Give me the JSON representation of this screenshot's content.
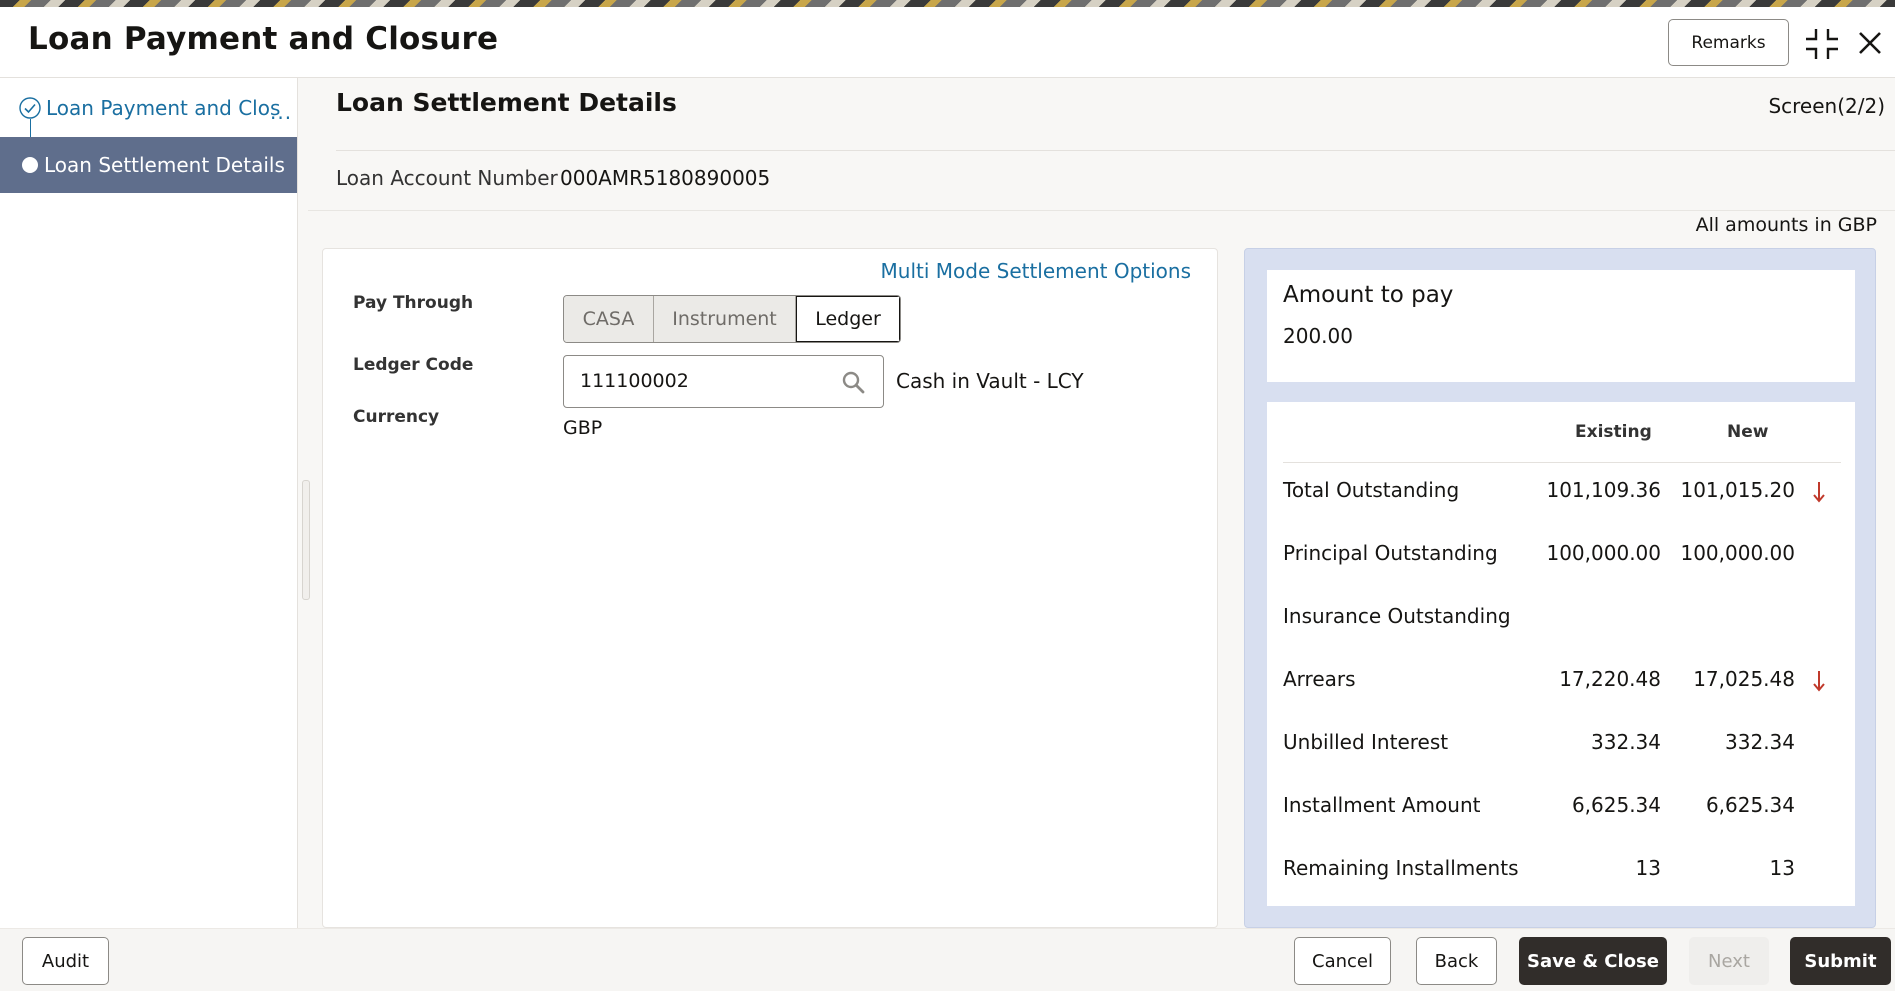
{
  "window": {
    "title": "Loan Payment and Closure",
    "remarks_label": "Remarks",
    "minimize_icon": "collapse-icon",
    "close_icon": "close-icon"
  },
  "sidebar": {
    "steps": [
      {
        "label": "Loan Payment and Clos",
        "truncated_suffix": "...",
        "state": "completed"
      },
      {
        "label": "Loan Settlement Details",
        "state": "active"
      }
    ]
  },
  "main": {
    "section_title": "Loan Settlement Details",
    "screen_indicator": "Screen(2/2)",
    "loan_account_label": "Loan Account Number",
    "loan_account_value": "000AMR5180890005",
    "amounts_note": "All amounts in GBP"
  },
  "form": {
    "multi_mode_link": "Multi Mode Settlement Options",
    "pay_through_label": "Pay Through",
    "pay_through_options": [
      "CASA",
      "Instrument",
      "Ledger"
    ],
    "pay_through_selected": "Ledger",
    "ledger_code_label": "Ledger Code",
    "ledger_code_value": "111100002",
    "ledger_code_description": "Cash in Vault - LCY",
    "currency_label": "Currency",
    "currency_value": "GBP"
  },
  "summary": {
    "amount_to_pay_title": "Amount to pay",
    "amount_to_pay_value": "200.00",
    "col_existing": "Existing",
    "col_new": "New",
    "rows": [
      {
        "label": "Total Outstanding",
        "existing": "101,109.36",
        "new": "101,015.20",
        "decreased": true
      },
      {
        "label": "Principal Outstanding",
        "existing": "100,000.00",
        "new": "100,000.00",
        "decreased": false
      },
      {
        "label": "Insurance Outstanding",
        "existing": "",
        "new": "",
        "decreased": false
      },
      {
        "label": "Arrears",
        "existing": "17,220.48",
        "new": "17,025.48",
        "decreased": true
      },
      {
        "label": "Unbilled Interest",
        "existing": "332.34",
        "new": "332.34",
        "decreased": false
      },
      {
        "label": "Installment Amount",
        "existing": "6,625.34",
        "new": "6,625.34",
        "decreased": false
      },
      {
        "label": "Remaining Installments",
        "existing": "13",
        "new": "13",
        "decreased": false
      }
    ],
    "decrease_color": "#c0392b"
  },
  "footer": {
    "audit": "Audit",
    "cancel": "Cancel",
    "back": "Back",
    "save_close": "Save & Close",
    "next": "Next",
    "submit": "Submit"
  },
  "colors": {
    "link": "#1a6fa1",
    "nav_active_bg": "#5f6e8c",
    "summary_panel_bg": "#d8dff0",
    "primary_button": "#312d2a"
  }
}
